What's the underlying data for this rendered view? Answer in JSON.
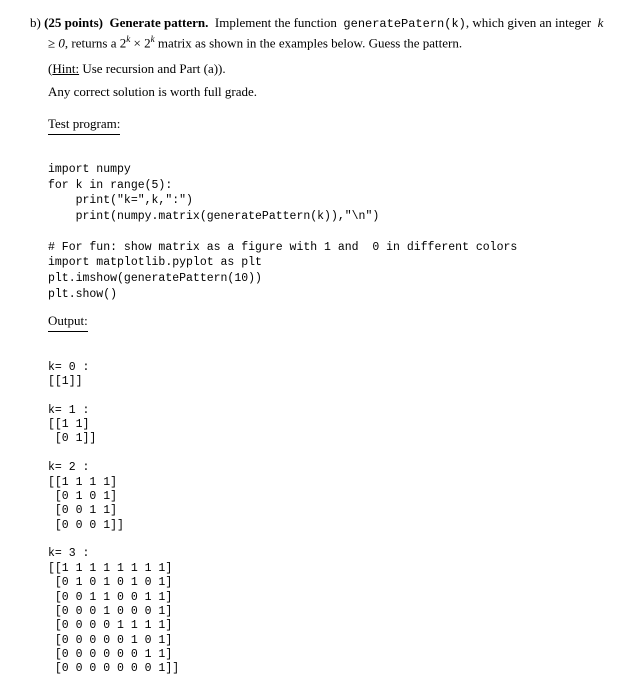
{
  "part_label": "b)",
  "points_label": "(25 points)",
  "title": "Generate pattern.",
  "instruction_prefix": "Implement the function",
  "function_name": "generatePatern(k)",
  "instruction_mid": ", which given an integer",
  "k_expr": "k ≥ 0",
  "instruction_suffix": ", returns a 2",
  "sup_k": "k",
  "times": " × 2",
  "instruction_end": " matrix as shown in the examples below. Guess the pattern.",
  "hint_open": "(",
  "hint_word": "Hint:",
  "hint_text": " Use recursion and Part (a)).",
  "grade_text": "Any correct solution is worth full grade.",
  "test_program_heading": "Test program:",
  "code": {
    "import_numpy": "import numpy",
    "for_line": "for k in range(5):",
    "print1": "    print(\"k=\",k,\":\")",
    "print2": "    print(numpy.matrix(generatePattern(k)),\"\\n\")",
    "comment": "# For fun: show matrix as a figure with 1 and  0 in different colors",
    "import_plt": "import matplotlib.pyplot as plt",
    "imshow": "plt.imshow(generatePattern(10))",
    "show": "plt.show()"
  },
  "output_heading": "Output:",
  "output": {
    "k0_header": "k= 0 :",
    "k0_r0": "[[1]]",
    "k1_header": "k= 1 :",
    "k1_r0": "[[1 1]",
    "k1_r1": " [0 1]]",
    "k2_header": "k= 2 :",
    "k2_r0": "[[1 1 1 1]",
    "k2_r1": " [0 1 0 1]",
    "k2_r2": " [0 0 1 1]",
    "k2_r3": " [0 0 0 1]]",
    "k3_header": "k= 3 :",
    "k3_r0": "[[1 1 1 1 1 1 1 1]",
    "k3_r1": " [0 1 0 1 0 1 0 1]",
    "k3_r2": " [0 0 1 1 0 0 1 1]",
    "k3_r3": " [0 0 0 1 0 0 0 1]",
    "k3_r4": " [0 0 0 0 1 1 1 1]",
    "k3_r5": " [0 0 0 0 0 1 0 1]",
    "k3_r6": " [0 0 0 0 0 0 1 1]",
    "k3_r7": " [0 0 0 0 0 0 0 1]]"
  }
}
